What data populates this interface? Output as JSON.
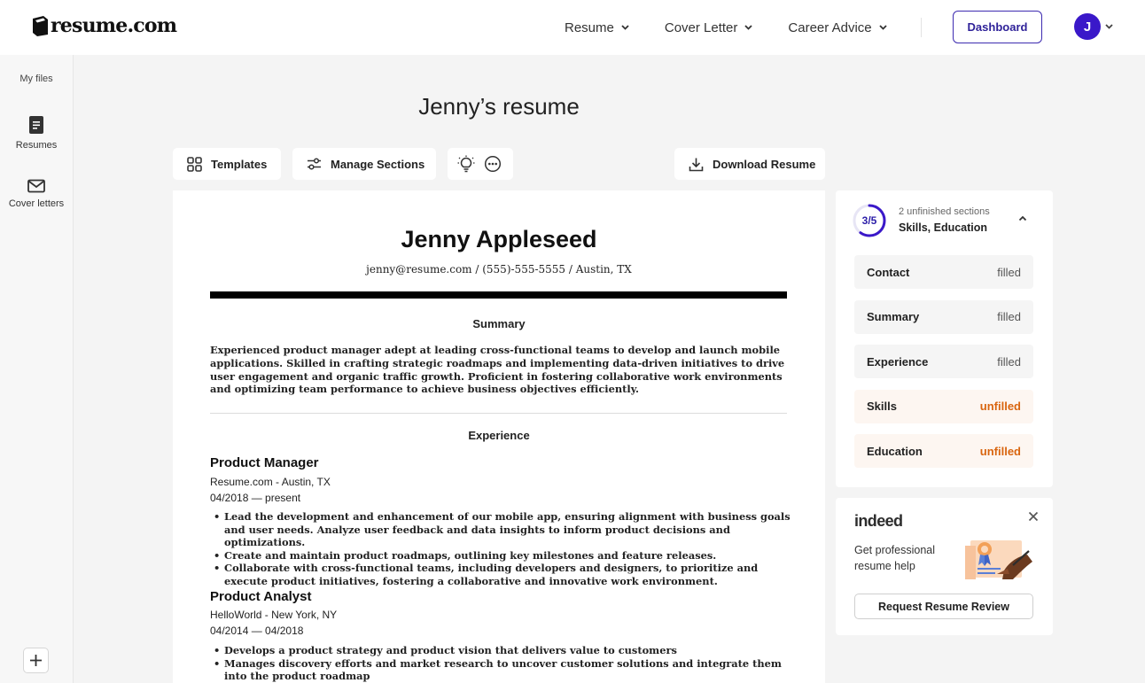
{
  "header": {
    "logo_text": "resume.com",
    "nav": [
      {
        "label": "Resume"
      },
      {
        "label": "Cover Letter"
      },
      {
        "label": "Career Advice"
      }
    ],
    "dashboard_label": "Dashboard",
    "avatar_initial": "J"
  },
  "sidebar": {
    "title": "My files",
    "items": [
      {
        "label": "Resumes",
        "icon": "document-icon"
      },
      {
        "label": "Cover letters",
        "icon": "envelope-icon"
      }
    ]
  },
  "page": {
    "title": "Jenny’s resume"
  },
  "toolbar": {
    "templates_label": "Templates",
    "manage_sections_label": "Manage Sections",
    "download_label": "Download Resume"
  },
  "resume": {
    "name": "Jenny Appleseed",
    "contact": "jenny@resume.com / (555)-555-5555 / Austin, TX",
    "summary_heading": "Summary",
    "summary": "Experienced product manager adept at leading cross-functional teams to develop and launch mobile applications. Skilled in crafting strategic roadmaps and implementing data-driven initiatives to drive user engagement and organic traffic growth. Proficient in fostering collaborative work environments and optimizing team performance to achieve business objectives efficiently.",
    "experience_heading": "Experience",
    "jobs": [
      {
        "title": "Product Manager",
        "company": "Resume.com - Austin, TX",
        "dates": "04/2018 — present",
        "bullets": [
          "Lead the development and enhancement of our mobile app, ensuring alignment with business goals and user needs. Analyze user feedback and data insights to inform product decisions and optimizations.",
          "Create and maintain product roadmaps, outlining key milestones and feature releases.",
          "Collaborate with cross-functional teams, including developers and designers, to prioritize and execute product initiatives, fostering a collaborative and innovative work environment."
        ]
      },
      {
        "title": "Product Analyst",
        "company": "HelloWorld - New York, NY",
        "dates": "04/2014 — 04/2018",
        "bullets": [
          "Develops a product strategy and product vision that delivers value to customers",
          "Manages discovery efforts and market research to uncover customer solutions and integrate them into the product roadmap"
        ]
      }
    ]
  },
  "progress": {
    "label": "3/5",
    "completed": 3,
    "total": 5,
    "unfinished_count": "2 unfinished sections",
    "unfinished_list": "Skills, Education",
    "sections": [
      {
        "name": "Contact",
        "status": "filled"
      },
      {
        "name": "Summary",
        "status": "filled"
      },
      {
        "name": "Experience",
        "status": "filled"
      },
      {
        "name": "Skills",
        "status": "unfilled"
      },
      {
        "name": "Education",
        "status": "unfilled"
      }
    ]
  },
  "promo": {
    "brand": "indeed",
    "text": "Get professional resume help",
    "button_label": "Request Resume Review"
  },
  "colors": {
    "accent": "#3a18c9",
    "unfilled": "#d9650f",
    "background": "#f4f4f4"
  }
}
